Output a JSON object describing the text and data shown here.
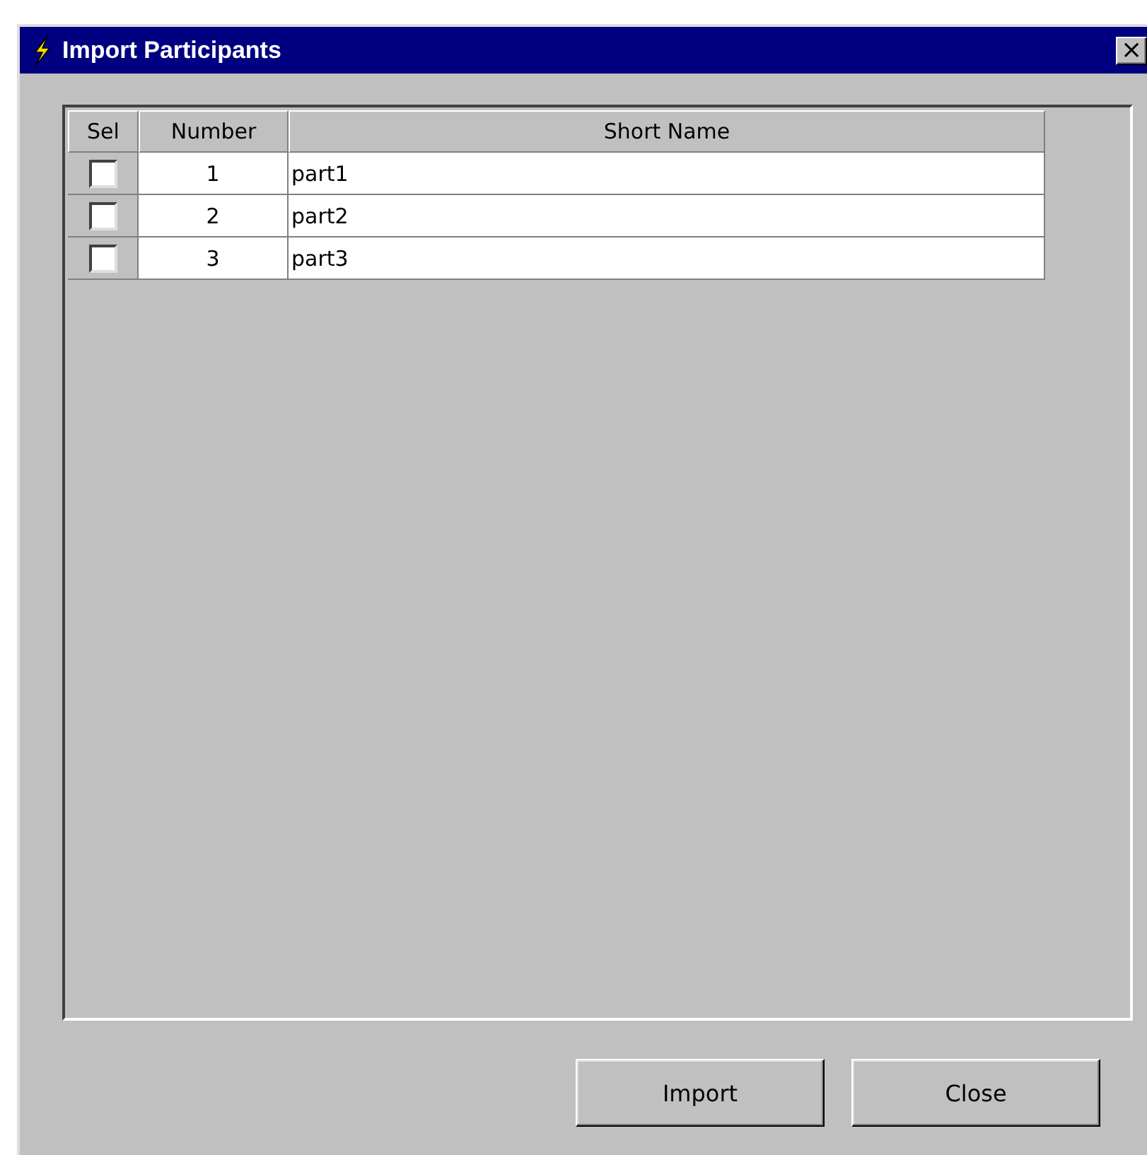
{
  "window": {
    "title": "Import Participants",
    "close": "×"
  },
  "table": {
    "columns": [
      "Sel",
      "Number",
      "Short Name"
    ],
    "rows": [
      {
        "checked": false,
        "number": "1",
        "short_name": "part1"
      },
      {
        "checked": false,
        "number": "2",
        "short_name": "part2"
      },
      {
        "checked": false,
        "number": "3",
        "short_name": "part3"
      }
    ]
  },
  "buttons": [
    "Import",
    "Close"
  ]
}
